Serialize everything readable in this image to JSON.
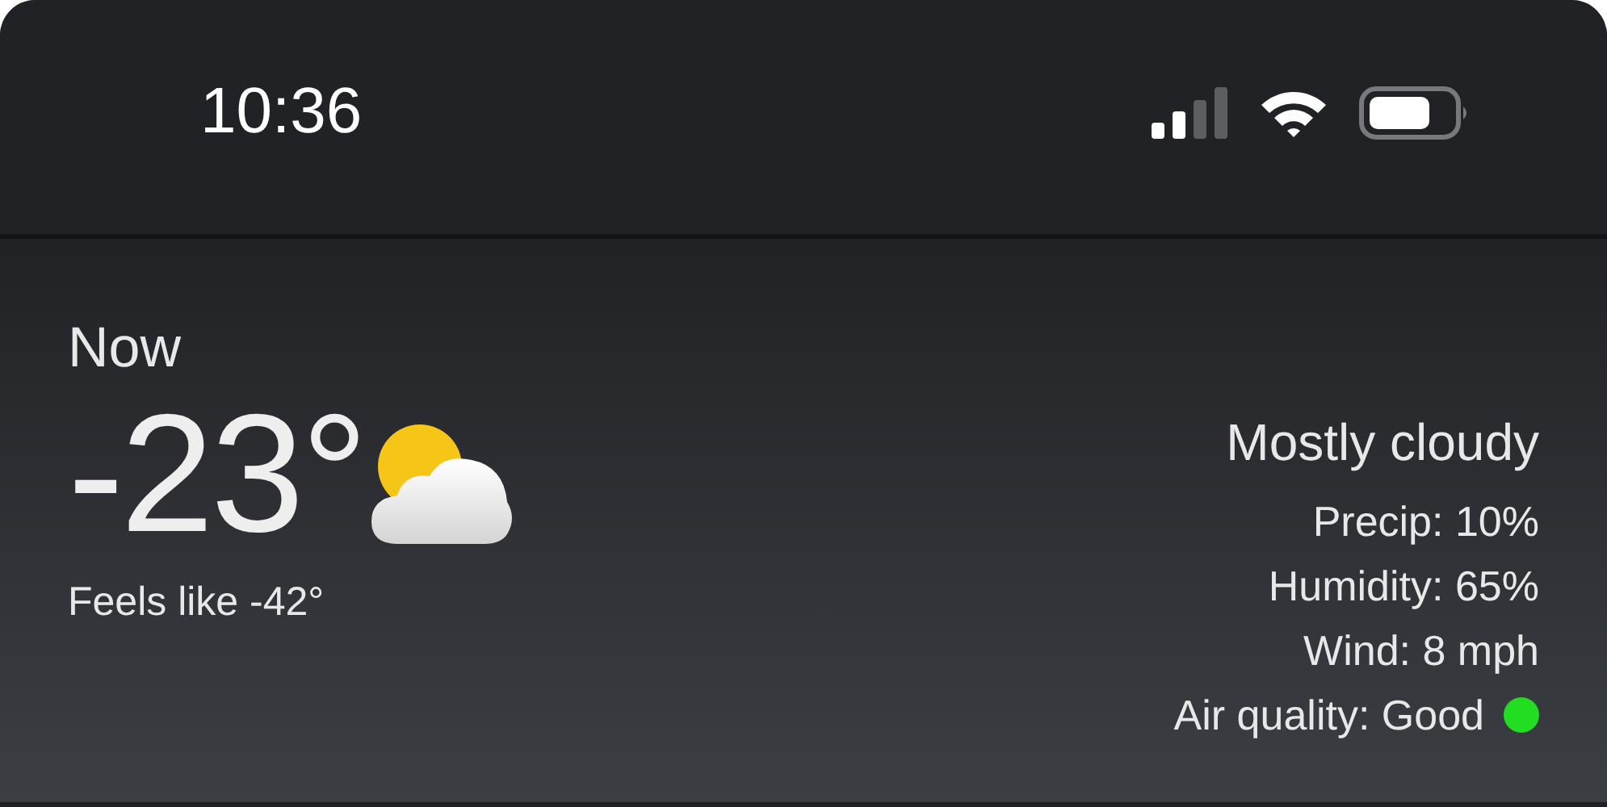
{
  "status_bar": {
    "time": "10:36"
  },
  "current": {
    "label": "Now",
    "temperature": "-23°",
    "feels_like": "Feels like -42°"
  },
  "details": {
    "condition": "Mostly cloudy",
    "rows": [
      {
        "text": "Precip: 10%"
      },
      {
        "text": "Humidity: 65%"
      },
      {
        "text": "Wind: 8 mph"
      },
      {
        "text": "Air quality: Good",
        "color": "#22dd22"
      }
    ]
  }
}
